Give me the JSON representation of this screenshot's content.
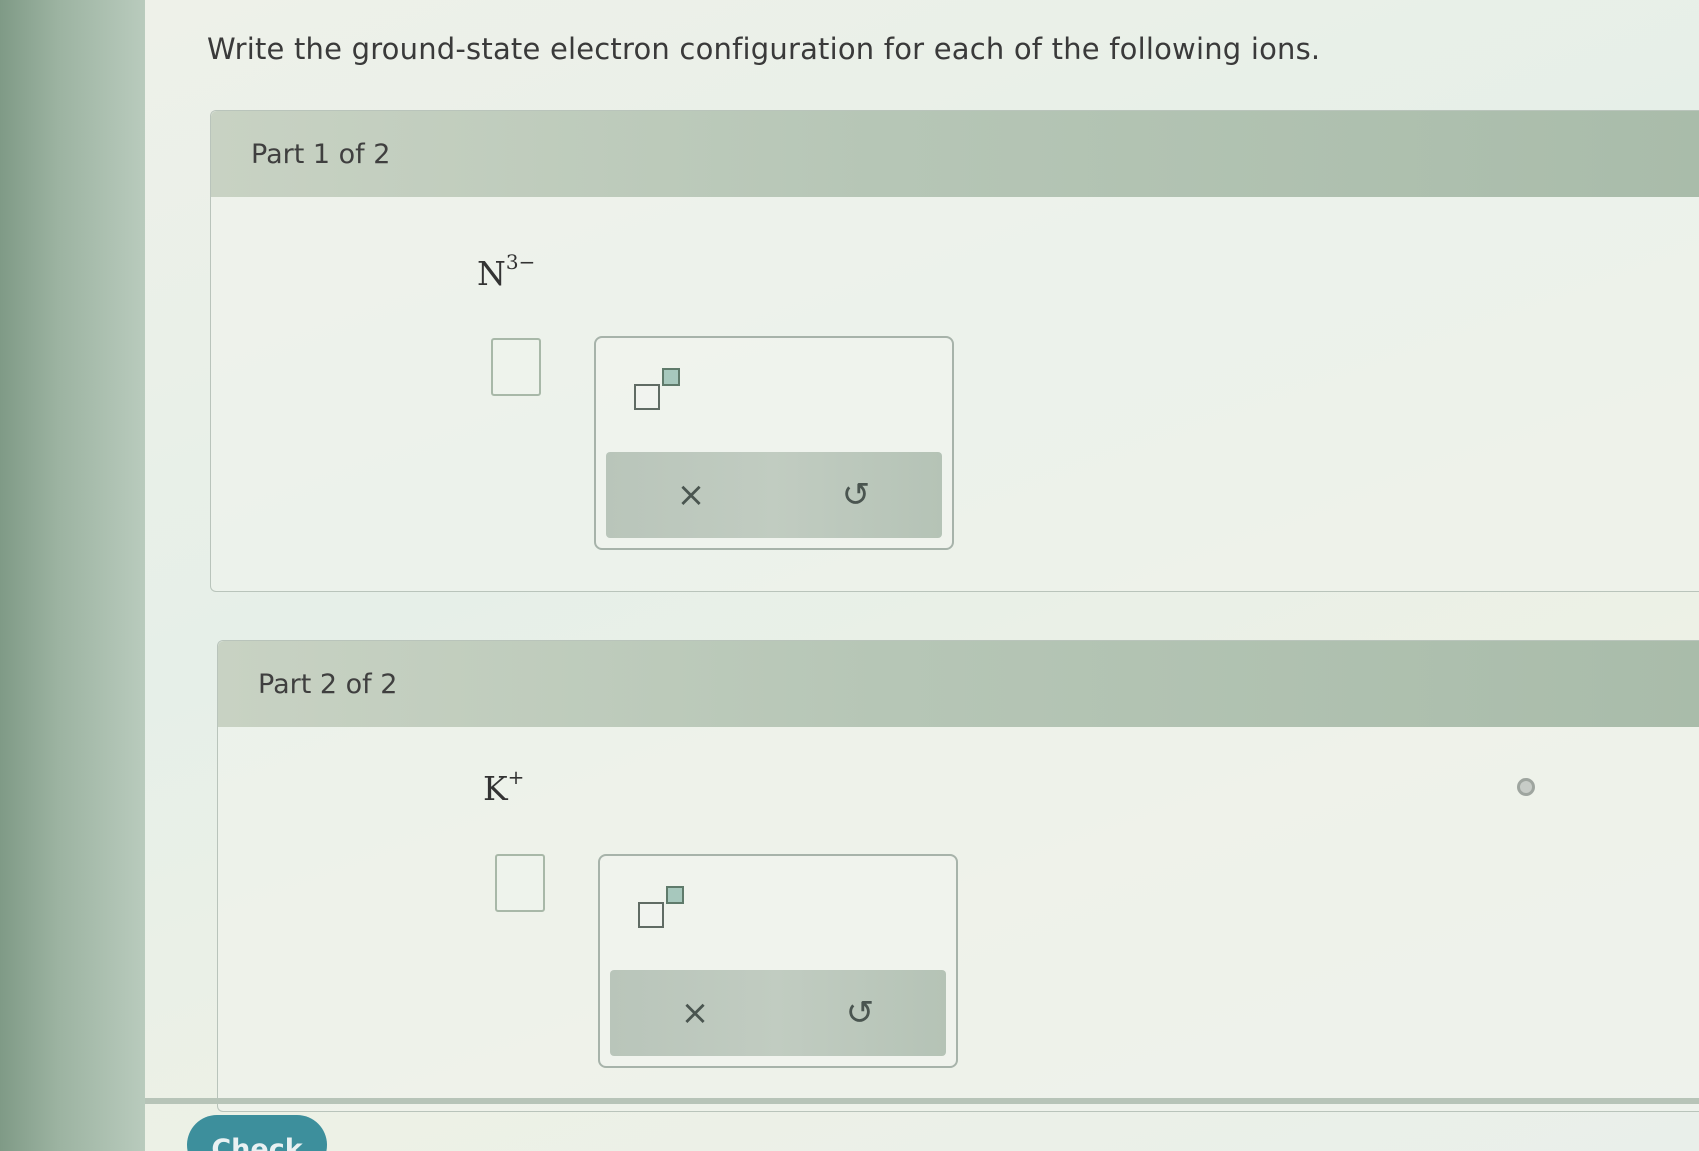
{
  "question": "Write the ground-state electron configuration for each of the following ions.",
  "parts": [
    {
      "header": "Part 1 of 2",
      "ion_symbol": "N",
      "ion_charge": "3−"
    },
    {
      "header": "Part 2 of 2",
      "ion_symbol": "K",
      "ion_charge": "+"
    }
  ],
  "tools": {
    "clear_glyph": "×",
    "undo_glyph": "↺"
  },
  "check_label": "Check"
}
